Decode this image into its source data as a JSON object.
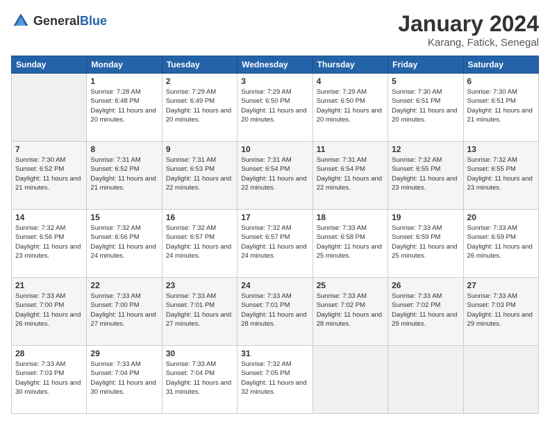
{
  "logo": {
    "general": "General",
    "blue": "Blue"
  },
  "title": "January 2024",
  "subtitle": "Karang, Fatick, Senegal",
  "headers": [
    "Sunday",
    "Monday",
    "Tuesday",
    "Wednesday",
    "Thursday",
    "Friday",
    "Saturday"
  ],
  "weeks": [
    [
      {
        "day": "",
        "sunrise": "",
        "sunset": "",
        "daylight": "",
        "empty": true
      },
      {
        "day": "1",
        "sunrise": "Sunrise: 7:28 AM",
        "sunset": "Sunset: 6:48 PM",
        "daylight": "Daylight: 11 hours and 20 minutes."
      },
      {
        "day": "2",
        "sunrise": "Sunrise: 7:29 AM",
        "sunset": "Sunset: 6:49 PM",
        "daylight": "Daylight: 11 hours and 20 minutes."
      },
      {
        "day": "3",
        "sunrise": "Sunrise: 7:29 AM",
        "sunset": "Sunset: 6:50 PM",
        "daylight": "Daylight: 11 hours and 20 minutes."
      },
      {
        "day": "4",
        "sunrise": "Sunrise: 7:29 AM",
        "sunset": "Sunset: 6:50 PM",
        "daylight": "Daylight: 11 hours and 20 minutes."
      },
      {
        "day": "5",
        "sunrise": "Sunrise: 7:30 AM",
        "sunset": "Sunset: 6:51 PM",
        "daylight": "Daylight: 11 hours and 20 minutes."
      },
      {
        "day": "6",
        "sunrise": "Sunrise: 7:30 AM",
        "sunset": "Sunset: 6:51 PM",
        "daylight": "Daylight: 11 hours and 21 minutes."
      }
    ],
    [
      {
        "day": "7",
        "sunrise": "Sunrise: 7:30 AM",
        "sunset": "Sunset: 6:52 PM",
        "daylight": "Daylight: 11 hours and 21 minutes."
      },
      {
        "day": "8",
        "sunrise": "Sunrise: 7:31 AM",
        "sunset": "Sunset: 6:52 PM",
        "daylight": "Daylight: 11 hours and 21 minutes."
      },
      {
        "day": "9",
        "sunrise": "Sunrise: 7:31 AM",
        "sunset": "Sunset: 6:53 PM",
        "daylight": "Daylight: 11 hours and 22 minutes."
      },
      {
        "day": "10",
        "sunrise": "Sunrise: 7:31 AM",
        "sunset": "Sunset: 6:54 PM",
        "daylight": "Daylight: 11 hours and 22 minutes."
      },
      {
        "day": "11",
        "sunrise": "Sunrise: 7:31 AM",
        "sunset": "Sunset: 6:54 PM",
        "daylight": "Daylight: 11 hours and 22 minutes."
      },
      {
        "day": "12",
        "sunrise": "Sunrise: 7:32 AM",
        "sunset": "Sunset: 6:55 PM",
        "daylight": "Daylight: 11 hours and 23 minutes."
      },
      {
        "day": "13",
        "sunrise": "Sunrise: 7:32 AM",
        "sunset": "Sunset: 6:55 PM",
        "daylight": "Daylight: 11 hours and 23 minutes."
      }
    ],
    [
      {
        "day": "14",
        "sunrise": "Sunrise: 7:32 AM",
        "sunset": "Sunset: 6:56 PM",
        "daylight": "Daylight: 11 hours and 23 minutes."
      },
      {
        "day": "15",
        "sunrise": "Sunrise: 7:32 AM",
        "sunset": "Sunset: 6:56 PM",
        "daylight": "Daylight: 11 hours and 24 minutes."
      },
      {
        "day": "16",
        "sunrise": "Sunrise: 7:32 AM",
        "sunset": "Sunset: 6:57 PM",
        "daylight": "Daylight: 11 hours and 24 minutes."
      },
      {
        "day": "17",
        "sunrise": "Sunrise: 7:32 AM",
        "sunset": "Sunset: 6:57 PM",
        "daylight": "Daylight: 11 hours and 24 minutes."
      },
      {
        "day": "18",
        "sunrise": "Sunrise: 7:33 AM",
        "sunset": "Sunset: 6:58 PM",
        "daylight": "Daylight: 11 hours and 25 minutes."
      },
      {
        "day": "19",
        "sunrise": "Sunrise: 7:33 AM",
        "sunset": "Sunset: 6:59 PM",
        "daylight": "Daylight: 11 hours and 25 minutes."
      },
      {
        "day": "20",
        "sunrise": "Sunrise: 7:33 AM",
        "sunset": "Sunset: 6:59 PM",
        "daylight": "Daylight: 11 hours and 26 minutes."
      }
    ],
    [
      {
        "day": "21",
        "sunrise": "Sunrise: 7:33 AM",
        "sunset": "Sunset: 7:00 PM",
        "daylight": "Daylight: 11 hours and 26 minutes."
      },
      {
        "day": "22",
        "sunrise": "Sunrise: 7:33 AM",
        "sunset": "Sunset: 7:00 PM",
        "daylight": "Daylight: 11 hours and 27 minutes."
      },
      {
        "day": "23",
        "sunrise": "Sunrise: 7:33 AM",
        "sunset": "Sunset: 7:01 PM",
        "daylight": "Daylight: 11 hours and 27 minutes."
      },
      {
        "day": "24",
        "sunrise": "Sunrise: 7:33 AM",
        "sunset": "Sunset: 7:01 PM",
        "daylight": "Daylight: 11 hours and 28 minutes."
      },
      {
        "day": "25",
        "sunrise": "Sunrise: 7:33 AM",
        "sunset": "Sunset: 7:02 PM",
        "daylight": "Daylight: 11 hours and 28 minutes."
      },
      {
        "day": "26",
        "sunrise": "Sunrise: 7:33 AM",
        "sunset": "Sunset: 7:02 PM",
        "daylight": "Daylight: 11 hours and 29 minutes."
      },
      {
        "day": "27",
        "sunrise": "Sunrise: 7:33 AM",
        "sunset": "Sunset: 7:03 PM",
        "daylight": "Daylight: 11 hours and 29 minutes."
      }
    ],
    [
      {
        "day": "28",
        "sunrise": "Sunrise: 7:33 AM",
        "sunset": "Sunset: 7:03 PM",
        "daylight": "Daylight: 11 hours and 30 minutes."
      },
      {
        "day": "29",
        "sunrise": "Sunrise: 7:33 AM",
        "sunset": "Sunset: 7:04 PM",
        "daylight": "Daylight: 11 hours and 30 minutes."
      },
      {
        "day": "30",
        "sunrise": "Sunrise: 7:33 AM",
        "sunset": "Sunset: 7:04 PM",
        "daylight": "Daylight: 11 hours and 31 minutes."
      },
      {
        "day": "31",
        "sunrise": "Sunrise: 7:32 AM",
        "sunset": "Sunset: 7:05 PM",
        "daylight": "Daylight: 11 hours and 32 minutes."
      },
      {
        "day": "",
        "sunrise": "",
        "sunset": "",
        "daylight": "",
        "empty": true
      },
      {
        "day": "",
        "sunrise": "",
        "sunset": "",
        "daylight": "",
        "empty": true
      },
      {
        "day": "",
        "sunrise": "",
        "sunset": "",
        "daylight": "",
        "empty": true
      }
    ]
  ]
}
